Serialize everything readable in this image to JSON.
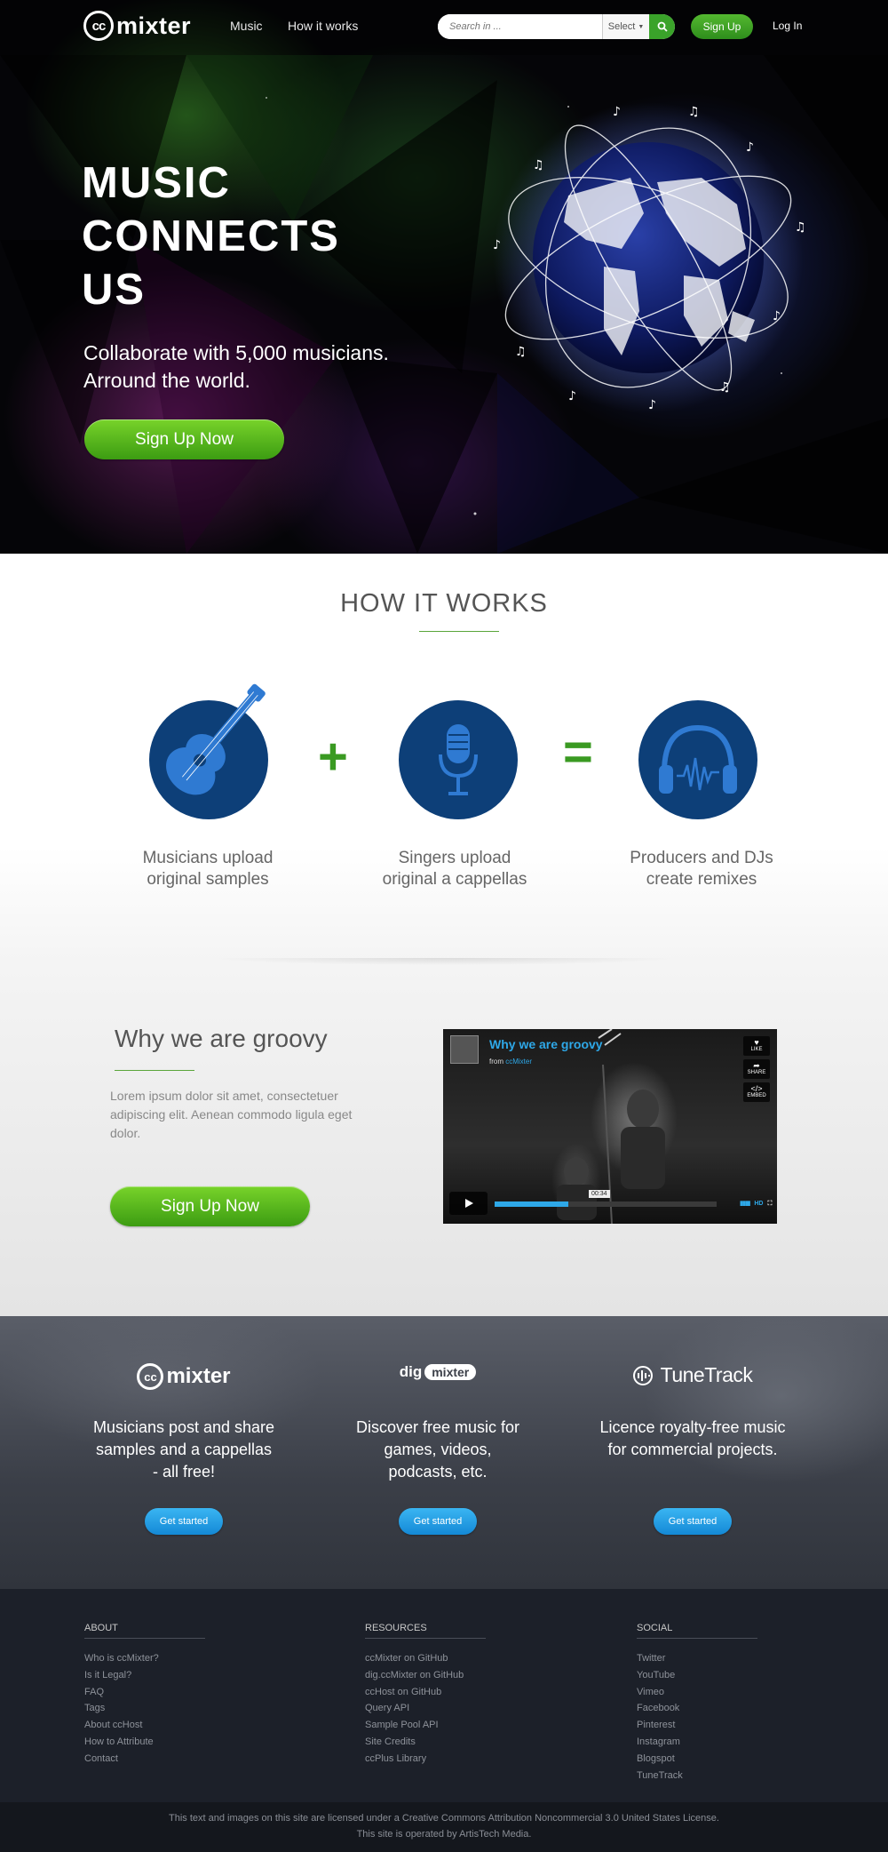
{
  "header": {
    "logo_cc": "cc",
    "logo_word": "mixter",
    "nav": [
      {
        "label": "Music"
      },
      {
        "label": "How it works"
      }
    ],
    "search": {
      "placeholder": "Search in ...",
      "select_label": "Select"
    },
    "signup_label": "Sign Up",
    "login_label": "Log In"
  },
  "hero": {
    "title": "MUSIC CONNECTS US",
    "subtitle_line1": "Collaborate with 5,000 musicians.",
    "subtitle_line2": "Arround the world.",
    "cta_label": "Sign Up Now"
  },
  "how_it_works": {
    "title": "HOW IT WORKS",
    "plus": "+",
    "equals": "=",
    "steps": [
      {
        "line1": "Musicians upload",
        "line2": "original samples",
        "icon": "guitar-icon"
      },
      {
        "line1": "Singers upload",
        "line2": "original a cappellas",
        "icon": "microphone-icon"
      },
      {
        "line1": "Producers and DJs",
        "line2": "create remixes",
        "icon": "headphones-icon"
      }
    ]
  },
  "groovy": {
    "title": "Why we are groovy",
    "text": "Lorem ipsum dolor sit amet, consectetuer adipiscing elit. Aenean commodo ligula eget dolor.",
    "cta_label": "Sign Up Now",
    "video": {
      "title": "Why we are groovy",
      "from_label": "from",
      "from_user": "ccMixter",
      "like_label": "LIKE",
      "share_label": "SHARE",
      "embed_label": "EMBED",
      "time": "00:34",
      "hd_label": "HD",
      "progress": 0.33
    }
  },
  "products": [
    {
      "logo_prefix": "cc",
      "logo_word": "mixter",
      "line1": "Musicians post and share",
      "line2": "samples and a cappellas",
      "line3": "- all free!",
      "button": "Get started"
    },
    {
      "logo_prefix": "dig",
      "logo_word": "mixter",
      "line1": "Discover free music for",
      "line2": "games, videos,",
      "line3": "podcasts, etc.",
      "button": "Get started"
    },
    {
      "logo_prefix": "",
      "logo_word": "TuneTrack",
      "line1": "Licence royalty-free music",
      "line2": "for commercial projects.",
      "line3": "",
      "button": "Get started"
    }
  ],
  "footer": {
    "about": {
      "heading": "ABOUT",
      "links": [
        "Who is ccMixter?",
        "Is it Legal?",
        "FAQ",
        "Tags",
        "About ccHost",
        "How to Attribute",
        "Contact"
      ]
    },
    "resources": {
      "heading": "RESOURCES",
      "links": [
        "ccMixter on GitHub",
        "dig.ccMixter on GitHub",
        "ccHost on GitHub",
        "Query API",
        "Sample Pool API",
        "Site Credits",
        "ccPlus Library"
      ]
    },
    "social": {
      "heading": "SOCIAL",
      "links": [
        "Twitter",
        "YouTube",
        "Vimeo",
        "Facebook",
        "Pinterest",
        "Instagram",
        "Blogspot",
        "TuneTrack"
      ]
    },
    "license_line": "This text and images on this site are licensed under a Creative Commons Attribution Noncommercial 3.0 United States License.",
    "operator_line": "This site is operated by ArtisTech Media."
  },
  "colors": {
    "accent_green": "#3a9a22",
    "icon_circle": "#0d3f78",
    "video_blue": "#2ea8e8",
    "button_blue": "#1e9be3"
  }
}
